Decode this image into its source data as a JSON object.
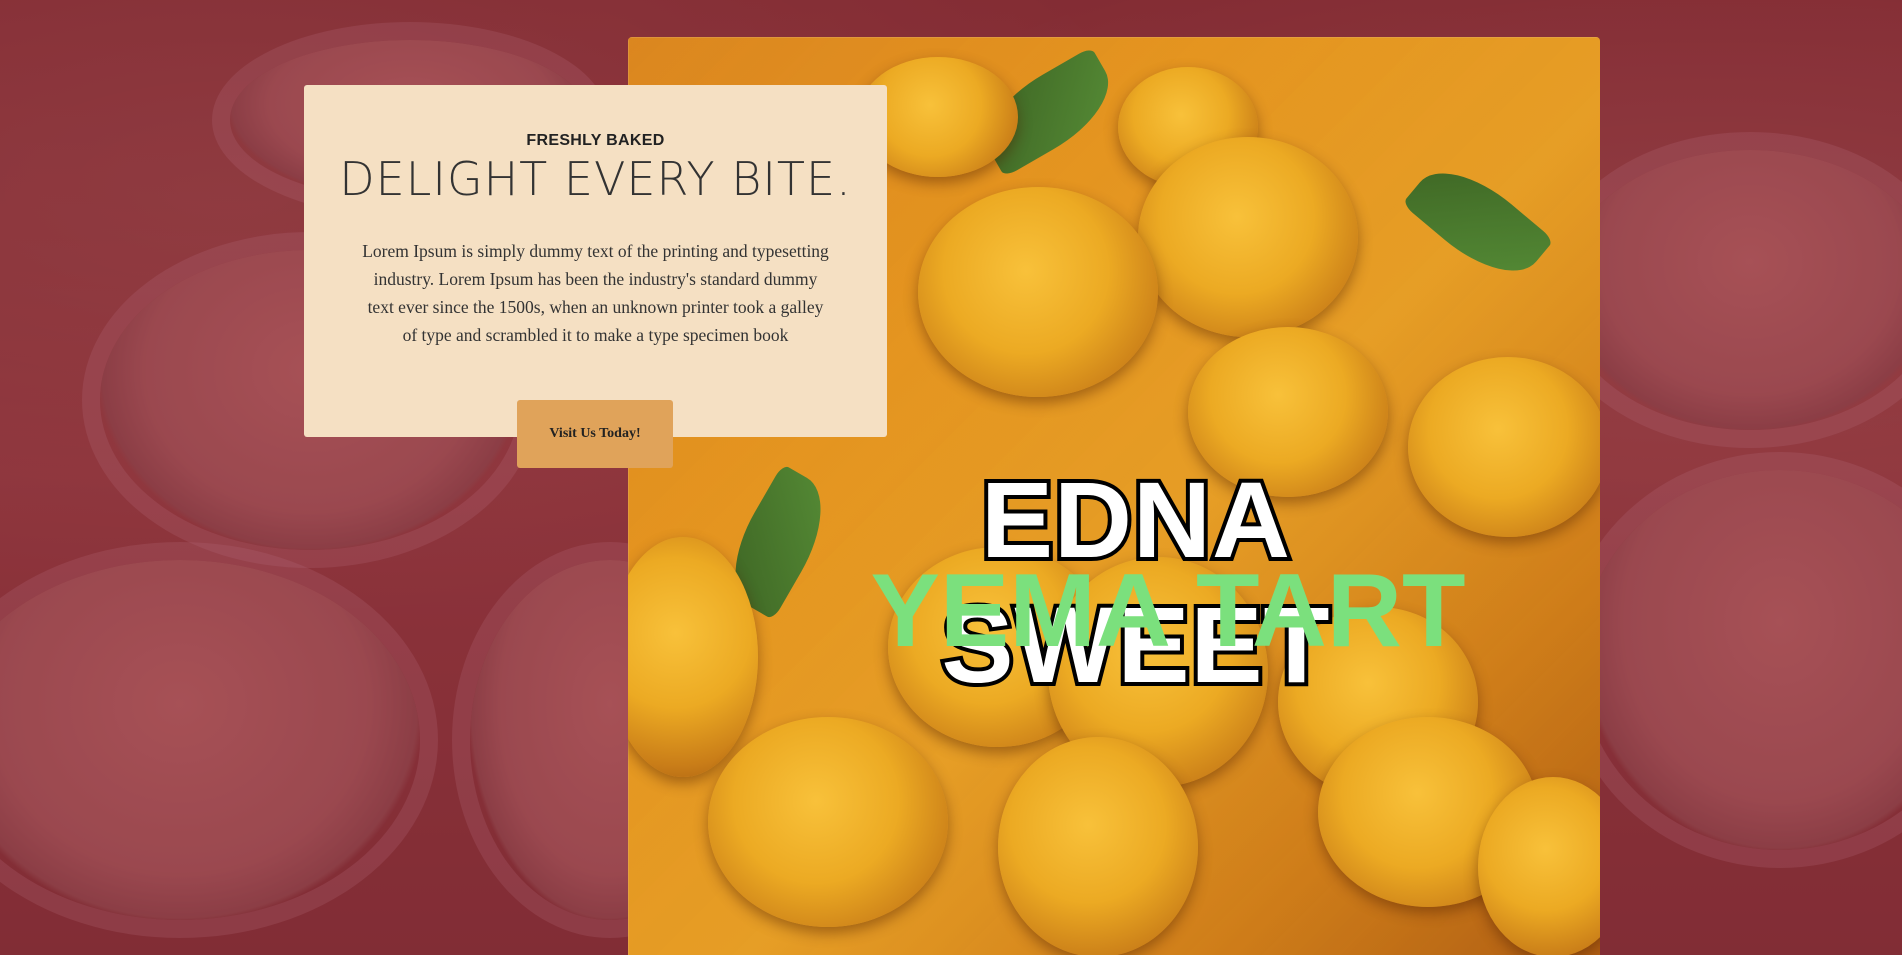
{
  "hero": {
    "eyebrow": "FRESHLY BAKED",
    "headline": "DELIGHT EVERY BITE.",
    "body": "Lorem Ipsum is simply dummy text of the printing and typesetting industry. Lorem Ipsum has been the industry's standard dummy text ever since the 1500s, when an unknown printer took a galley of type and scrambled it to make a type specimen book",
    "cta_label": "Visit Us Today!"
  },
  "feature_image": {
    "line1": "EDNA SWEET",
    "line2": "YEMA TART"
  },
  "colors": {
    "card_bg": "#f5e0c3",
    "cta_bg": "#e0a35a",
    "background_tint": "#8a3a40",
    "yema_text": "#7be07d"
  }
}
